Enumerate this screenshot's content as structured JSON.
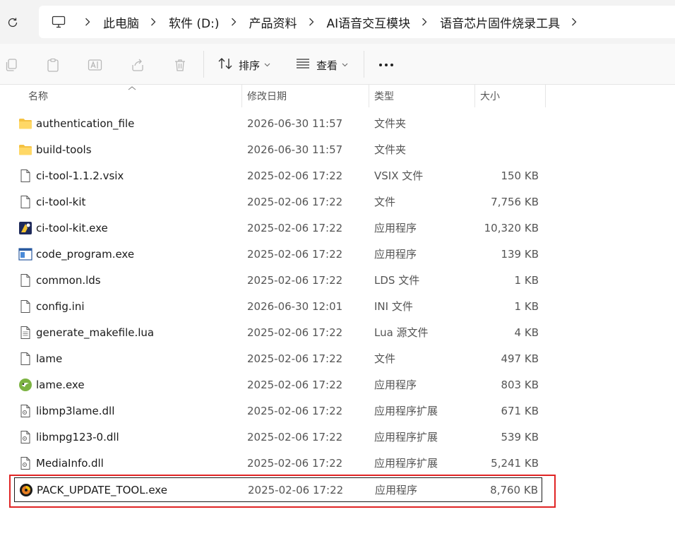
{
  "breadcrumb": [
    "此电脑",
    "软件 (D:)",
    "产品资料",
    "AI语音交互模块",
    "语音芯片固件烧录工具"
  ],
  "toolbar": {
    "sort_label": "排序",
    "view_label": "查看"
  },
  "columns": {
    "name": "名称",
    "modified": "修改日期",
    "type": "类型",
    "size": "大小"
  },
  "files": [
    {
      "name": "authentication_file",
      "modified": "2026-06-30 11:57",
      "type": "文件夹",
      "size": "",
      "icon": "folder-icon"
    },
    {
      "name": "build-tools",
      "modified": "2026-06-30 11:57",
      "type": "文件夹",
      "size": "",
      "icon": "folder-icon"
    },
    {
      "name": "ci-tool-1.1.2.vsix",
      "modified": "2025-02-06 17:22",
      "type": "VSIX 文件",
      "size": "150 KB",
      "icon": "file-icon"
    },
    {
      "name": "ci-tool-kit",
      "modified": "2025-02-06 17:22",
      "type": "文件",
      "size": "7,756 KB",
      "icon": "file-icon"
    },
    {
      "name": "ci-tool-kit.exe",
      "modified": "2025-02-06 17:22",
      "type": "应用程序",
      "size": "10,320 KB",
      "icon": "app-icon"
    },
    {
      "name": "code_program.exe",
      "modified": "2025-02-06 17:22",
      "type": "应用程序",
      "size": "139 KB",
      "icon": "window-app-icon"
    },
    {
      "name": "common.lds",
      "modified": "2025-02-06 17:22",
      "type": "LDS 文件",
      "size": "1 KB",
      "icon": "file-icon"
    },
    {
      "name": "config.ini",
      "modified": "2026-06-30 12:01",
      "type": "INI 文件",
      "size": "1 KB",
      "icon": "file-icon"
    },
    {
      "name": "generate_makefile.lua",
      "modified": "2025-02-06 17:22",
      "type": "Lua 源文件",
      "size": "4 KB",
      "icon": "text-file-icon"
    },
    {
      "name": "lame",
      "modified": "2025-02-06 17:22",
      "type": "文件",
      "size": "497 KB",
      "icon": "file-icon"
    },
    {
      "name": "lame.exe",
      "modified": "2025-02-06 17:22",
      "type": "应用程序",
      "size": "803 KB",
      "icon": "lame-app-icon"
    },
    {
      "name": "libmp3lame.dll",
      "modified": "2025-02-06 17:22",
      "type": "应用程序扩展",
      "size": "671 KB",
      "icon": "dll-icon"
    },
    {
      "name": "libmpg123-0.dll",
      "modified": "2025-02-06 17:22",
      "type": "应用程序扩展",
      "size": "539 KB",
      "icon": "dll-icon"
    },
    {
      "name": "MediaInfo.dll",
      "modified": "2025-02-06 17:22",
      "type": "应用程序扩展",
      "size": "5,241 KB",
      "icon": "dll-icon"
    },
    {
      "name": "PACK_UPDATE_TOOL.exe",
      "modified": "2025-02-06 17:22",
      "type": "应用程序",
      "size": "8,760 KB",
      "icon": "pack-app-icon",
      "selected": true
    }
  ],
  "colors": {
    "highlight": "#e02424",
    "folder": "#f5c242"
  }
}
